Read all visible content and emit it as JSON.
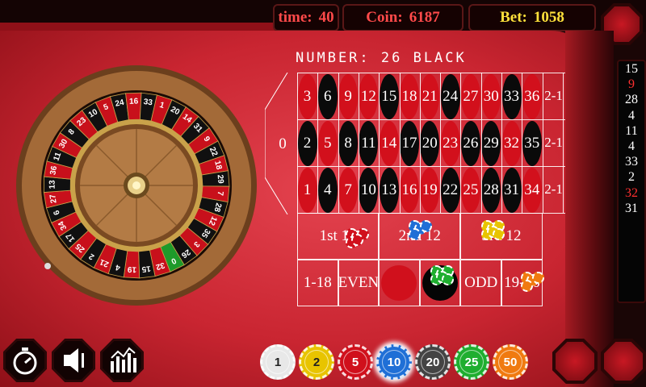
{
  "hud": {
    "time_label": "time:",
    "time_value": "40",
    "coin_label": "Coin:",
    "coin_value": "6187",
    "bet_label": "Bet:",
    "bet_value": "1058"
  },
  "result_text": "NUMBER: 26 BLACK",
  "history": [
    "15",
    "9",
    "28",
    "4",
    "11",
    "4",
    "33",
    "2",
    "32",
    "31"
  ],
  "history_colors": [
    "#ffffff",
    "#ff3030",
    "#ffffff",
    "#ffffff",
    "#ffffff",
    "#ffffff",
    "#ffffff",
    "#ffffff",
    "#ff3030",
    "#ffffff"
  ],
  "wheel_numbers": [
    "0",
    "32",
    "15",
    "19",
    "4",
    "21",
    "2",
    "25",
    "17",
    "34",
    "6",
    "27",
    "13",
    "36",
    "11",
    "30",
    "8",
    "23",
    "10",
    "5",
    "24",
    "16",
    "33",
    "1",
    "20",
    "14",
    "31",
    "9",
    "22",
    "18",
    "29",
    "7",
    "28",
    "12",
    "35",
    "3",
    "26"
  ],
  "table": {
    "zero": "0",
    "rows": [
      [
        "3",
        "6",
        "9",
        "12",
        "15",
        "18",
        "21",
        "24",
        "27",
        "30",
        "33",
        "36"
      ],
      [
        "2",
        "5",
        "8",
        "11",
        "14",
        "17",
        "20",
        "23",
        "26",
        "29",
        "32",
        "35"
      ],
      [
        "1",
        "4",
        "7",
        "10",
        "13",
        "16",
        "19",
        "22",
        "25",
        "28",
        "31",
        "34"
      ]
    ],
    "red_numbers": [
      "1",
      "3",
      "5",
      "7",
      "9",
      "12",
      "14",
      "16",
      "18",
      "19",
      "21",
      "23",
      "25",
      "27",
      "30",
      "32",
      "34",
      "36"
    ],
    "column_bets": [
      "2-1",
      "2-1",
      "2-1"
    ],
    "dozens": [
      "1st 12",
      "2nd 12",
      "3rd 12"
    ],
    "outside": [
      "1-18",
      "EVEN",
      "",
      "",
      "ODD",
      "19-36"
    ]
  },
  "chips": [
    {
      "value": "1",
      "color": "#e8e8e8",
      "text": "#222222"
    },
    {
      "value": "2",
      "color": "#e8c400",
      "text": "#222222"
    },
    {
      "value": "5",
      "color": "#d0101c",
      "text": "#ffffff"
    },
    {
      "value": "10",
      "color": "#1f6fd6",
      "text": "#ffffff"
    },
    {
      "value": "20",
      "color": "#444444",
      "text": "#ffffff"
    },
    {
      "value": "25",
      "color": "#1fae2f",
      "text": "#ffffff"
    },
    {
      "value": "50",
      "color": "#f07a10",
      "text": "#ffffff"
    }
  ],
  "selected_chip": "10",
  "controls": [
    "timer-icon",
    "sound-icon",
    "stats-icon"
  ]
}
